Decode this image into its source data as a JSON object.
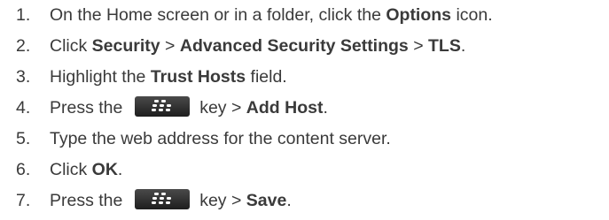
{
  "steps": [
    {
      "number": "1.",
      "parts": [
        "On the Home screen or in a folder, click the ",
        "Options",
        " icon."
      ]
    },
    {
      "number": "2.",
      "parts": [
        "Click ",
        "Security",
        " > ",
        "Advanced Security Settings",
        " > ",
        "TLS",
        "."
      ]
    },
    {
      "number": "3.",
      "parts": [
        "Highlight the ",
        "Trust Hosts",
        " field."
      ]
    },
    {
      "number": "4.",
      "parts": [
        "Press the ",
        " key > ",
        "Add Host",
        "."
      ],
      "icon": "blackberry-menu-key-icon"
    },
    {
      "number": "5.",
      "parts": [
        "Type the web address for the content server."
      ]
    },
    {
      "number": "6.",
      "parts": [
        "Click ",
        "OK",
        "."
      ]
    },
    {
      "number": "7.",
      "parts": [
        "Press the ",
        " key > ",
        "Save",
        "."
      ],
      "icon": "blackberry-menu-key-icon"
    }
  ],
  "colors": {
    "text": "#3a3a3a",
    "key_background": "#2b2b2b",
    "key_glyph": "#ffffff"
  }
}
